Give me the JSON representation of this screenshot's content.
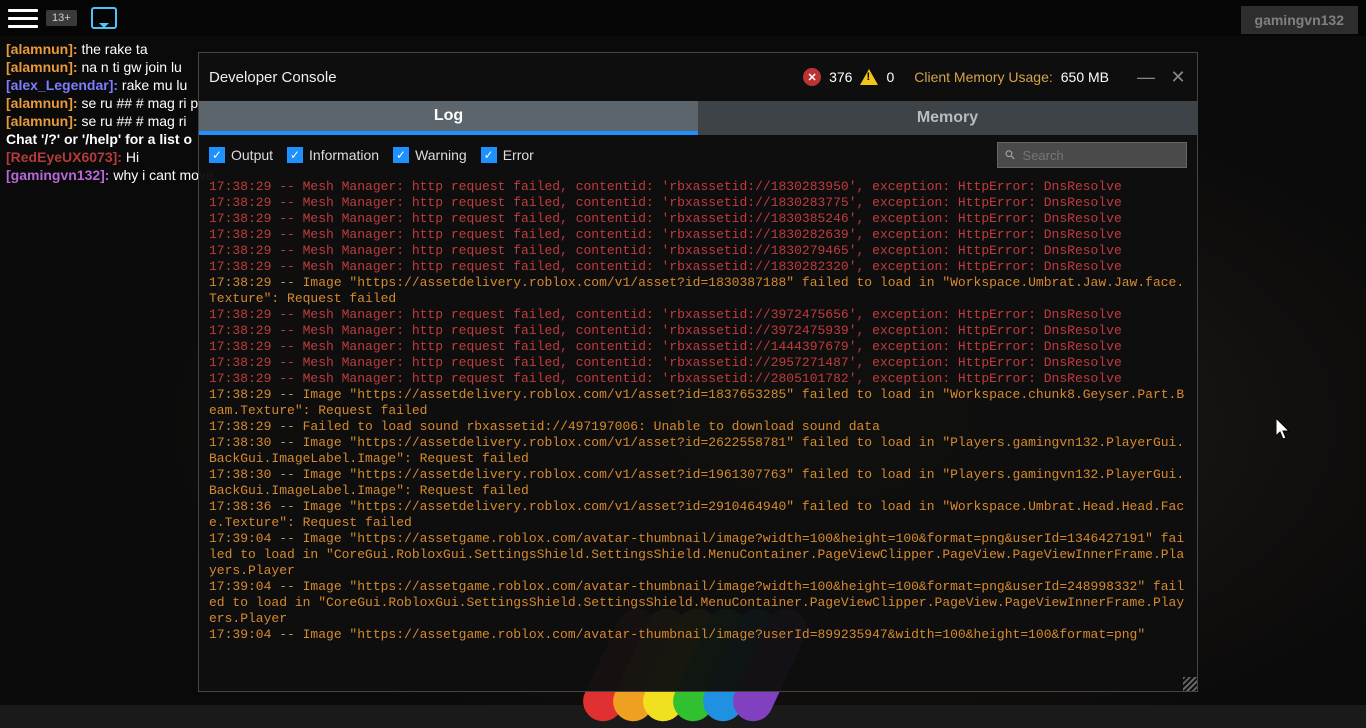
{
  "topbar": {
    "age_badge": "13+",
    "username": "gamingvn132"
  },
  "chat_colors": {
    "alamnun": "#e89a3c",
    "alex_Legendar": "#7d7dff",
    "system": "#ffffff",
    "RedEyeUX6073": "#b33b3b",
    "gamingvn132": "#b768d6"
  },
  "chat": [
    {
      "user": "[alamnun]:",
      "color_key": "alamnun",
      "msg": " the rake ta"
    },
    {
      "user": "[alamnun]:",
      "color_key": "alamnun",
      "msg": " na n ti gw join lu"
    },
    {
      "user": "[alex_Legendar]:",
      "color_key": "alex_Legendar",
      "msg": " rake mu lu"
    },
    {
      "user": "[alamnun]:",
      "color_key": "alamnun",
      "msg": " se ru ## # mag ri p"
    },
    {
      "user": "[alamnun]:",
      "color_key": "alamnun",
      "msg": " se ru ## # mag ri"
    },
    {
      "user": "Chat '/?' or '/help' for a list o",
      "color_key": "system",
      "msg": ""
    },
    {
      "user": "[RedEyeUX6073]:",
      "color_key": "RedEyeUX6073",
      "msg": " Hi"
    },
    {
      "user": "[gamingvn132]:",
      "color_key": "gamingvn132",
      "msg": " why i cant move"
    }
  ],
  "console": {
    "title": "Developer Console",
    "errors": "376",
    "warnings": "0",
    "mem_label": "Client Memory Usage:",
    "mem_value": "650 MB",
    "tabs": {
      "log": "Log",
      "memory": "Memory"
    },
    "filters": {
      "output": "Output",
      "information": "Information",
      "warning": "Warning",
      "error": "Error"
    },
    "search_placeholder": "Search"
  },
  "log": [
    {
      "t": "red",
      "text": "17:38:29 -- Mesh Manager: http request failed, contentid: 'rbxassetid://1830283950', exception: HttpError: DnsResolve"
    },
    {
      "t": "red",
      "text": "17:38:29 -- Mesh Manager: http request failed, contentid: 'rbxassetid://1830283775', exception: HttpError: DnsResolve"
    },
    {
      "t": "red",
      "text": "17:38:29 -- Mesh Manager: http request failed, contentid: 'rbxassetid://1830385246', exception: HttpError: DnsResolve"
    },
    {
      "t": "red",
      "text": "17:38:29 -- Mesh Manager: http request failed, contentid: 'rbxassetid://1830282639', exception: HttpError: DnsResolve"
    },
    {
      "t": "red",
      "text": "17:38:29 -- Mesh Manager: http request failed, contentid: 'rbxassetid://1830279465', exception: HttpError: DnsResolve"
    },
    {
      "t": "red",
      "text": "17:38:29 -- Mesh Manager: http request failed, contentid: 'rbxassetid://1830282320', exception: HttpError: DnsResolve"
    },
    {
      "t": "orange",
      "text": "17:38:29 -- Image \"https://assetdelivery.roblox.com/v1/asset?id=1830387188\" failed to load in \"Workspace.Umbrat.Jaw.Jaw.face.Texture\": Request failed"
    },
    {
      "t": "red",
      "text": "17:38:29 -- Mesh Manager: http request failed, contentid: 'rbxassetid://3972475656', exception: HttpError: DnsResolve"
    },
    {
      "t": "red",
      "text": "17:38:29 -- Mesh Manager: http request failed, contentid: 'rbxassetid://3972475939', exception: HttpError: DnsResolve"
    },
    {
      "t": "red",
      "text": "17:38:29 -- Mesh Manager: http request failed, contentid: 'rbxassetid://1444397679', exception: HttpError: DnsResolve"
    },
    {
      "t": "red",
      "text": "17:38:29 -- Mesh Manager: http request failed, contentid: 'rbxassetid://2957271487', exception: HttpError: DnsResolve"
    },
    {
      "t": "red",
      "text": "17:38:29 -- Mesh Manager: http request failed, contentid: 'rbxassetid://2805101782', exception: HttpError: DnsResolve"
    },
    {
      "t": "orange",
      "text": "17:38:29 -- Image \"https://assetdelivery.roblox.com/v1/asset?id=1837653285\" failed to load in \"Workspace.chunk8.Geyser.Part.Beam.Texture\": Request failed"
    },
    {
      "t": "orange",
      "text": "17:38:29 -- Failed to load sound rbxassetid://497197006: Unable to download sound data"
    },
    {
      "t": "orange",
      "text": "17:38:30 -- Image \"https://assetdelivery.roblox.com/v1/asset?id=2622558781\" failed to load in \"Players.gamingvn132.PlayerGui.BackGui.ImageLabel.Image\": Request failed"
    },
    {
      "t": "orange",
      "text": "17:38:30 -- Image \"https://assetdelivery.roblox.com/v1/asset?id=1961307763\" failed to load in \"Players.gamingvn132.PlayerGui.BackGui.ImageLabel.Image\": Request failed"
    },
    {
      "t": "orange",
      "text": "17:38:36 -- Image \"https://assetdelivery.roblox.com/v1/asset?id=2910464940\" failed to load in \"Workspace.Umbrat.Head.Head.Face.Texture\": Request failed"
    },
    {
      "t": "orange",
      "text": "17:39:04 -- Image \"https://assetgame.roblox.com/avatar-thumbnail/image?width=100&height=100&format=png&userId=1346427191\" failed to load in \"CoreGui.RobloxGui.SettingsShield.SettingsShield.MenuContainer.PageViewClipper.PageView.PageViewInnerFrame.Players.Player"
    },
    {
      "t": "orange",
      "text": "17:39:04 -- Image \"https://assetgame.roblox.com/avatar-thumbnail/image?width=100&height=100&format=png&userId=248998332\" failed to load in \"CoreGui.RobloxGui.SettingsShield.SettingsShield.MenuContainer.PageViewClipper.PageView.PageViewInnerFrame.Players.Player"
    },
    {
      "t": "orange",
      "text": "17:39:04 -- Image \"https://assetgame.roblox.com/avatar-thumbnail/image?userId=899235947&width=100&height=100&format=png\""
    }
  ]
}
